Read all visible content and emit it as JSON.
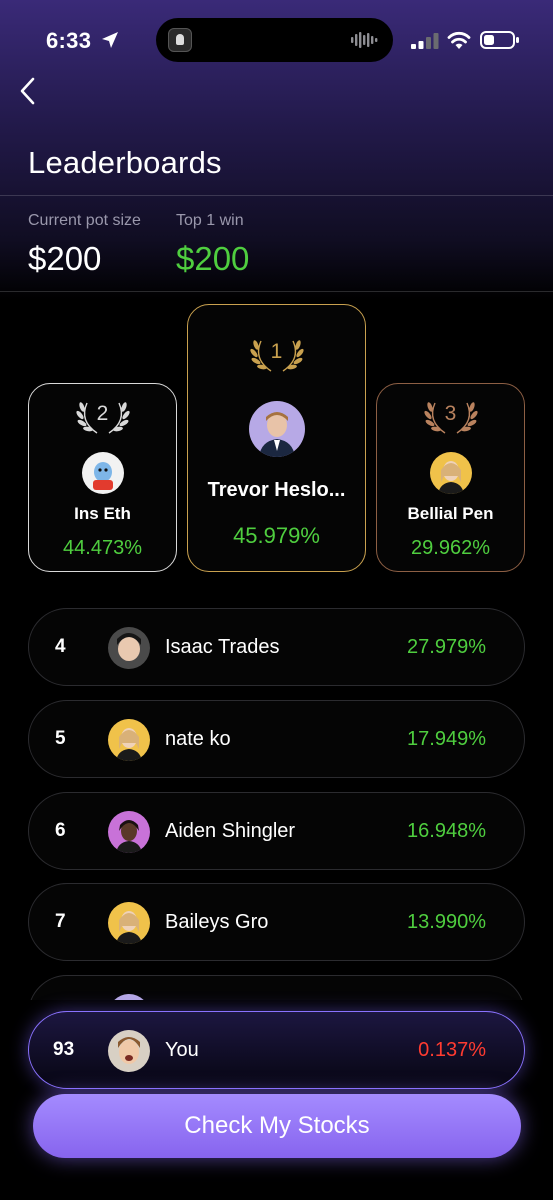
{
  "status_bar": {
    "time": "6:33"
  },
  "header": {
    "title": "Leaderboards"
  },
  "pot": {
    "label": "Current pot size",
    "value": "$200"
  },
  "top_win": {
    "label": "Top 1 win",
    "value": "$200"
  },
  "podium": [
    {
      "rank": "1",
      "name": "Trevor Heslo...",
      "pct": "45.979%"
    },
    {
      "rank": "2",
      "name": "Ins Eth",
      "pct": "44.473%"
    },
    {
      "rank": "3",
      "name": "Bellial Pen",
      "pct": "29.962%"
    }
  ],
  "rankings": [
    {
      "rank": "4",
      "name": "Isaac Trades",
      "pct": "27.979%"
    },
    {
      "rank": "5",
      "name": "nate ko",
      "pct": "17.949%"
    },
    {
      "rank": "6",
      "name": "Aiden Shingler",
      "pct": "16.948%"
    },
    {
      "rank": "7",
      "name": "Baileys Gro",
      "pct": "13.990%"
    }
  ],
  "current_user": {
    "rank": "93",
    "name": "You",
    "pct": "0.137%"
  },
  "cta": {
    "label": "Check My Stocks"
  },
  "colors": {
    "accent": "#8a72ff",
    "gain": "#4fce3f",
    "loss": "#ff3b30",
    "gold": "#c9a14f",
    "silver": "#d9d9d9",
    "bronze": "#8d5f44"
  }
}
